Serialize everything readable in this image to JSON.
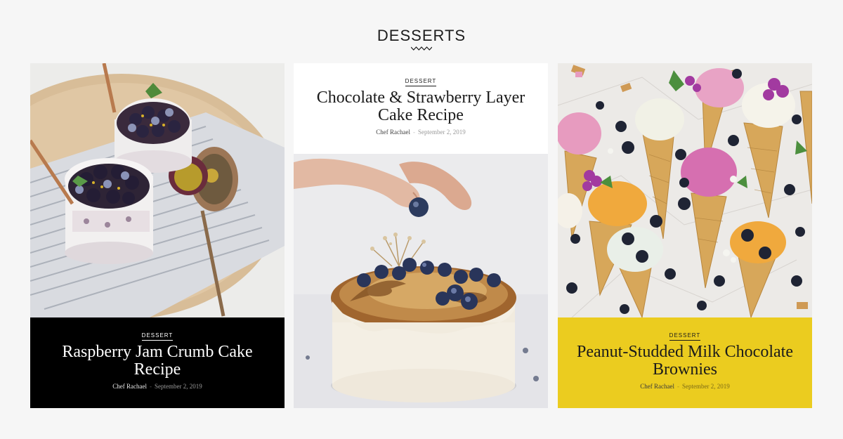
{
  "section": {
    "title": "DESSERTS"
  },
  "posts": [
    {
      "category": "DESSERT",
      "title": "Raspberry Jam Crumb Cake Recipe",
      "author": "Chef Rachael",
      "separator": "-",
      "date": "September 2, 2019",
      "image_icon": "blueberry-parfait-photo",
      "caption_bg": "#000000"
    },
    {
      "category": "DESSERT",
      "title": "Chocolate & Strawberry Layer Cake Recipe",
      "author": "Chef Rachael",
      "separator": "-",
      "date": "September 2, 2019",
      "image_icon": "blueberry-cake-photo",
      "caption_bg": "#ffffff"
    },
    {
      "category": "DESSERT",
      "title": "Peanut-Studded Milk Chocolate Brownies",
      "author": "Chef Rachael",
      "separator": "-",
      "date": "September 2, 2019",
      "image_icon": "ice-cream-cones-photo",
      "caption_bg": "#ebcc1f"
    }
  ],
  "colors": {
    "page_bg": "#f6f6f6",
    "accent_yellow": "#ebcc1f",
    "dark": "#000000"
  }
}
